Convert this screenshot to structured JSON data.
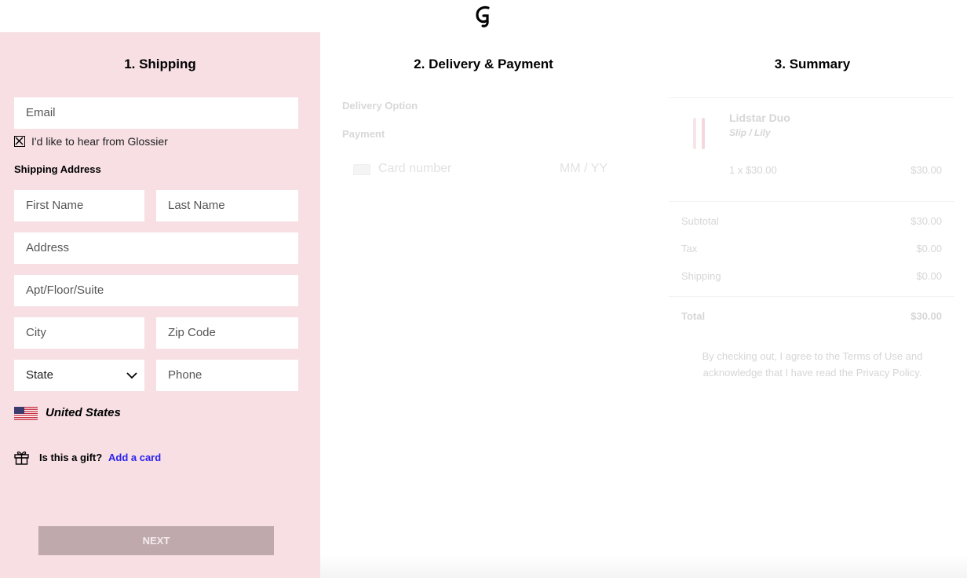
{
  "header": {
    "logo_icon": "glossier-g-logo-icon"
  },
  "shipping": {
    "title": "1. Shipping",
    "email_placeholder": "Email",
    "newsletter_label": "I'd like to hear from Glossier",
    "address_heading": "Shipping Address",
    "first_name_placeholder": "First Name",
    "last_name_placeholder": "Last Name",
    "address_placeholder": "Address",
    "apt_placeholder": "Apt/Floor/Suite",
    "city_placeholder": "City",
    "zip_placeholder": "Zip Code",
    "state_value": "State",
    "phone_placeholder": "Phone",
    "country": "United States",
    "gift_question": "Is this a gift?",
    "gift_link": "Add a card",
    "next_label": "NEXT"
  },
  "delivery": {
    "title": "2. Delivery & Payment",
    "delivery_option_label": "Delivery Option",
    "payment_label": "Payment",
    "card_number_placeholder": "Card number",
    "expiry_placeholder": "MM / YY"
  },
  "summary": {
    "title": "3. Summary",
    "product_name": "Lidstar Duo",
    "product_variant": "Slip / Lily",
    "product_qty_price": "1 x $30.00",
    "product_total": "$30.00",
    "subtotal_label": "Subtotal",
    "subtotal_value": "$30.00",
    "tax_label": "Tax",
    "tax_value": "$0.00",
    "shipping_label": "Shipping",
    "shipping_value": "$0.00",
    "total_label": "Total",
    "total_value": "$30.00",
    "terms": "By checking out, I agree to the Terms of Use and acknowledge that I have read the Privacy Policy."
  },
  "colors": {
    "shipping_bg": "#f7dfe4",
    "next_button_bg": "#bfa9ad",
    "link": "#2b22f0"
  }
}
